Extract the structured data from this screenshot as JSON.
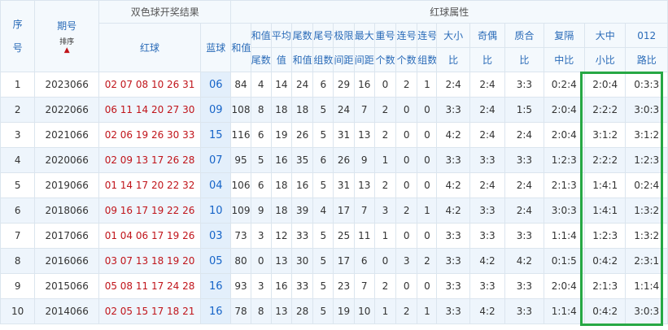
{
  "header": {
    "seq": [
      "序",
      "号"
    ],
    "period": "期号",
    "sort": "排序",
    "group_draw": "双色球开奖结果",
    "red": "红球",
    "blue": "蓝球",
    "group_attr": "红球属性",
    "sum": "和值",
    "cols": [
      [
        "和值",
        "尾数"
      ],
      [
        "平均",
        "值"
      ],
      [
        "尾数",
        "和值"
      ],
      [
        "尾号",
        "组数"
      ],
      [
        "极限",
        "间距"
      ],
      [
        "最大",
        "间距"
      ],
      [
        "重号",
        "个数"
      ],
      [
        "连号",
        "个数"
      ],
      [
        "连号",
        "组数"
      ],
      [
        "大小",
        "比"
      ],
      [
        "奇偶",
        "比"
      ],
      [
        "质合",
        "比"
      ],
      [
        "复隔",
        "中比"
      ],
      [
        "大中",
        "小比"
      ],
      [
        "012",
        "路比"
      ]
    ]
  },
  "rows": [
    {
      "n": "1",
      "p": "2023066",
      "r": "02 07 08 10 26 31",
      "b": "06",
      "v": [
        "84",
        "4",
        "14",
        "24",
        "6",
        "29",
        "16",
        "0",
        "2",
        "1",
        "2:4",
        "2:4",
        "3:3",
        "0:2:4",
        "2:0:4",
        "0:3:3"
      ]
    },
    {
      "n": "2",
      "p": "2022066",
      "r": "06 11 14 20 27 30",
      "b": "09",
      "v": [
        "108",
        "8",
        "18",
        "18",
        "5",
        "24",
        "7",
        "2",
        "0",
        "0",
        "3:3",
        "2:4",
        "1:5",
        "2:0:4",
        "2:2:2",
        "3:0:3"
      ]
    },
    {
      "n": "3",
      "p": "2021066",
      "r": "02 06 19 26 30 33",
      "b": "15",
      "v": [
        "116",
        "6",
        "19",
        "26",
        "5",
        "31",
        "13",
        "2",
        "0",
        "0",
        "4:2",
        "2:4",
        "2:4",
        "2:0:4",
        "3:1:2",
        "3:1:2"
      ]
    },
    {
      "n": "4",
      "p": "2020066",
      "r": "02 09 13 17 26 28",
      "b": "07",
      "v": [
        "95",
        "5",
        "16",
        "35",
        "6",
        "26",
        "9",
        "1",
        "0",
        "0",
        "3:3",
        "3:3",
        "3:3",
        "1:2:3",
        "2:2:2",
        "1:2:3"
      ]
    },
    {
      "n": "5",
      "p": "2019066",
      "r": "01 14 17 20 22 32",
      "b": "04",
      "v": [
        "106",
        "6",
        "18",
        "16",
        "5",
        "31",
        "13",
        "2",
        "0",
        "0",
        "4:2",
        "2:4",
        "2:4",
        "2:1:3",
        "1:4:1",
        "0:2:4"
      ]
    },
    {
      "n": "6",
      "p": "2018066",
      "r": "09 16 17 19 22 26",
      "b": "10",
      "v": [
        "109",
        "9",
        "18",
        "39",
        "4",
        "17",
        "7",
        "3",
        "2",
        "1",
        "4:2",
        "3:3",
        "2:4",
        "3:0:3",
        "1:4:1",
        "1:3:2"
      ]
    },
    {
      "n": "7",
      "p": "2017066",
      "r": "01 04 06 17 19 26",
      "b": "03",
      "v": [
        "73",
        "3",
        "12",
        "33",
        "5",
        "25",
        "11",
        "1",
        "0",
        "0",
        "3:3",
        "3:3",
        "3:3",
        "1:1:4",
        "1:2:3",
        "1:3:2"
      ]
    },
    {
      "n": "8",
      "p": "2016066",
      "r": "03 07 13 18 19 20",
      "b": "05",
      "v": [
        "80",
        "0",
        "13",
        "30",
        "5",
        "17",
        "6",
        "0",
        "3",
        "2",
        "3:3",
        "4:2",
        "4:2",
        "0:1:5",
        "0:4:2",
        "2:3:1"
      ]
    },
    {
      "n": "9",
      "p": "2015066",
      "r": "05 08 11 17 24 28",
      "b": "16",
      "v": [
        "93",
        "3",
        "16",
        "33",
        "5",
        "23",
        "7",
        "2",
        "0",
        "0",
        "3:3",
        "3:3",
        "3:3",
        "2:0:4",
        "2:1:3",
        "1:1:4"
      ]
    },
    {
      "n": "10",
      "p": "2014066",
      "r": "02 05 15 17 18 21",
      "b": "16",
      "v": [
        "78",
        "8",
        "13",
        "28",
        "5",
        "19",
        "10",
        "1",
        "2",
        "1",
        "3:3",
        "4:2",
        "3:3",
        "1:1:4",
        "0:4:2",
        "3:0:3"
      ]
    }
  ]
}
